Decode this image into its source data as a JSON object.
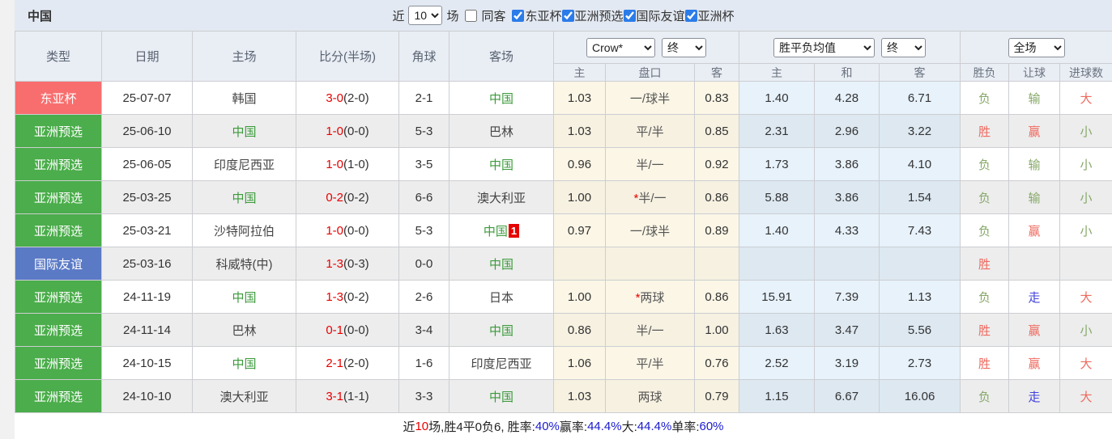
{
  "page": {
    "team_title": "中国",
    "top_bar": {
      "recent_label": "近",
      "count_value": "10",
      "count_suffix": "场",
      "filters": [
        {
          "label": "同客",
          "checked": false
        },
        {
          "label": "东亚杯",
          "checked": true
        },
        {
          "label": "亚洲预选",
          "checked": true
        },
        {
          "label": "国际友谊",
          "checked": true
        },
        {
          "label": "亚洲杯",
          "checked": true
        }
      ]
    }
  },
  "table": {
    "headers": {
      "type": "类型",
      "date": "日期",
      "home": "主场",
      "score": "比分(半场)",
      "corner": "角球",
      "away": "客场",
      "odds_company_select": "Crow*",
      "odds_time_select": "终",
      "odds_sub": [
        "主",
        "盘口",
        "客"
      ],
      "mean_select": "胜平负均值",
      "mean_time_select": "终",
      "mean_sub": [
        "主",
        "和",
        "客"
      ],
      "scope_select": "全场",
      "result_sub": [
        "胜负",
        "让球",
        "进球数"
      ]
    },
    "rows": [
      {
        "type": "东亚杯",
        "type_color": "red",
        "date": "25-07-07",
        "home": "韩国",
        "home_cn": false,
        "score": "3-0",
        "half": "(2-0)",
        "corner": "2-1",
        "away": "中国",
        "away_cn": true,
        "away_badge": "",
        "o1": "1.03",
        "hc_star": false,
        "hc": "一/球半",
        "o2": "0.83",
        "m1": "1.40",
        "m2": "4.28",
        "m3": "6.71",
        "wl": "负",
        "wl_c": "green",
        "lr": "输",
        "lr_c": "green",
        "gs": "大",
        "gs_c": "red"
      },
      {
        "type": "亚洲预选",
        "type_color": "green",
        "date": "25-06-10",
        "home": "中国",
        "home_cn": true,
        "score": "1-0",
        "half": "(0-0)",
        "corner": "5-3",
        "away": "巴林",
        "away_cn": false,
        "away_badge": "",
        "o1": "1.03",
        "hc_star": false,
        "hc": "平/半",
        "o2": "0.85",
        "m1": "2.31",
        "m2": "2.96",
        "m3": "3.22",
        "wl": "胜",
        "wl_c": "red",
        "lr": "赢",
        "lr_c": "red",
        "gs": "小",
        "gs_c": "green"
      },
      {
        "type": "亚洲预选",
        "type_color": "green",
        "date": "25-06-05",
        "home": "印度尼西亚",
        "home_cn": false,
        "score": "1-0",
        "half": "(1-0)",
        "corner": "3-5",
        "away": "中国",
        "away_cn": true,
        "away_badge": "",
        "o1": "0.96",
        "hc_star": false,
        "hc": "半/一",
        "o2": "0.92",
        "m1": "1.73",
        "m2": "3.86",
        "m3": "4.10",
        "wl": "负",
        "wl_c": "green",
        "lr": "输",
        "lr_c": "green",
        "gs": "小",
        "gs_c": "green"
      },
      {
        "type": "亚洲预选",
        "type_color": "green",
        "date": "25-03-25",
        "home": "中国",
        "home_cn": true,
        "score": "0-2",
        "half": "(0-2)",
        "corner": "6-6",
        "away": "澳大利亚",
        "away_cn": false,
        "away_badge": "",
        "o1": "1.00",
        "hc_star": true,
        "hc": "半/一",
        "o2": "0.86",
        "m1": "5.88",
        "m2": "3.86",
        "m3": "1.54",
        "wl": "负",
        "wl_c": "green",
        "lr": "输",
        "lr_c": "green",
        "gs": "小",
        "gs_c": "green"
      },
      {
        "type": "亚洲预选",
        "type_color": "green",
        "date": "25-03-21",
        "home": "沙特阿拉伯",
        "home_cn": false,
        "score": "1-0",
        "half": "(0-0)",
        "corner": "5-3",
        "away": "中国",
        "away_cn": true,
        "away_badge": "1",
        "o1": "0.97",
        "hc_star": false,
        "hc": "一/球半",
        "o2": "0.89",
        "m1": "1.40",
        "m2": "4.33",
        "m3": "7.43",
        "wl": "负",
        "wl_c": "green",
        "lr": "赢",
        "lr_c": "red",
        "gs": "小",
        "gs_c": "green"
      },
      {
        "type": "国际友谊",
        "type_color": "blue",
        "date": "25-03-16",
        "home": "科威特(中)",
        "home_cn": false,
        "score": "1-3",
        "half": "(0-3)",
        "corner": "0-0",
        "away": "中国",
        "away_cn": true,
        "away_badge": "",
        "o1": "",
        "hc_star": false,
        "hc": "",
        "o2": "",
        "m1": "",
        "m2": "",
        "m3": "",
        "wl": "胜",
        "wl_c": "red",
        "lr": "",
        "lr_c": "none",
        "gs": "",
        "gs_c": "none"
      },
      {
        "type": "亚洲预选",
        "type_color": "green",
        "date": "24-11-19",
        "home": "中国",
        "home_cn": true,
        "score": "1-3",
        "half": "(0-2)",
        "corner": "2-6",
        "away": "日本",
        "away_cn": false,
        "away_badge": "",
        "o1": "1.00",
        "hc_star": true,
        "hc": "两球",
        "o2": "0.86",
        "m1": "15.91",
        "m2": "7.39",
        "m3": "1.13",
        "wl": "负",
        "wl_c": "green",
        "lr": "走",
        "lr_c": "blue",
        "gs": "大",
        "gs_c": "red"
      },
      {
        "type": "亚洲预选",
        "type_color": "green",
        "date": "24-11-14",
        "home": "巴林",
        "home_cn": false,
        "score": "0-1",
        "half": "(0-0)",
        "corner": "3-4",
        "away": "中国",
        "away_cn": true,
        "away_badge": "",
        "o1": "0.86",
        "hc_star": false,
        "hc": "半/一",
        "o2": "1.00",
        "m1": "1.63",
        "m2": "3.47",
        "m3": "5.56",
        "wl": "胜",
        "wl_c": "red",
        "lr": "赢",
        "lr_c": "red",
        "gs": "小",
        "gs_c": "green"
      },
      {
        "type": "亚洲预选",
        "type_color": "green",
        "date": "24-10-15",
        "home": "中国",
        "home_cn": true,
        "score": "2-1",
        "half": "(2-0)",
        "corner": "1-6",
        "away": "印度尼西亚",
        "away_cn": false,
        "away_badge": "",
        "o1": "1.06",
        "hc_star": false,
        "hc": "平/半",
        "o2": "0.76",
        "m1": "2.52",
        "m2": "3.19",
        "m3": "2.73",
        "wl": "胜",
        "wl_c": "red",
        "lr": "赢",
        "lr_c": "red",
        "gs": "大",
        "gs_c": "red"
      },
      {
        "type": "亚洲预选",
        "type_color": "green",
        "date": "24-10-10",
        "home": "澳大利亚",
        "home_cn": false,
        "score": "3-1",
        "half": "(1-1)",
        "corner": "3-3",
        "away": "中国",
        "away_cn": true,
        "away_badge": "",
        "o1": "1.03",
        "hc_star": false,
        "hc": "两球",
        "o2": "0.79",
        "m1": "1.15",
        "m2": "6.67",
        "m3": "16.06",
        "wl": "负",
        "wl_c": "green",
        "lr": "走",
        "lr_c": "blue",
        "gs": "大",
        "gs_c": "red"
      }
    ]
  },
  "footer": {
    "segments": [
      {
        "text": "近",
        "color": "black"
      },
      {
        "text": "10",
        "color": "red"
      },
      {
        "text": "场,胜4平0负6, 胜率:",
        "color": "black"
      },
      {
        "text": "40%",
        "color": "blue"
      },
      {
        "text": " 赢率:",
        "color": "black"
      },
      {
        "text": "44.4%",
        "color": "blue"
      },
      {
        "text": " 大:",
        "color": "black"
      },
      {
        "text": "44.4%",
        "color": "blue"
      },
      {
        "text": " 单率:",
        "color": "black"
      },
      {
        "text": "60%",
        "color": "blue"
      }
    ]
  },
  "colors": {
    "type_red": "#f86e6e",
    "type_green": "#4bad4b",
    "type_blue": "#5b7ac6",
    "score_red": "#e80000",
    "china_green": "#3c9a3c",
    "result_red": "#ee6a5f",
    "result_green": "#86a868",
    "result_blue": "#4343dd",
    "footer_blue": "#1a1acd",
    "topbar_bg": "#e3e9f2",
    "header_bg": "#e9edf4"
  }
}
